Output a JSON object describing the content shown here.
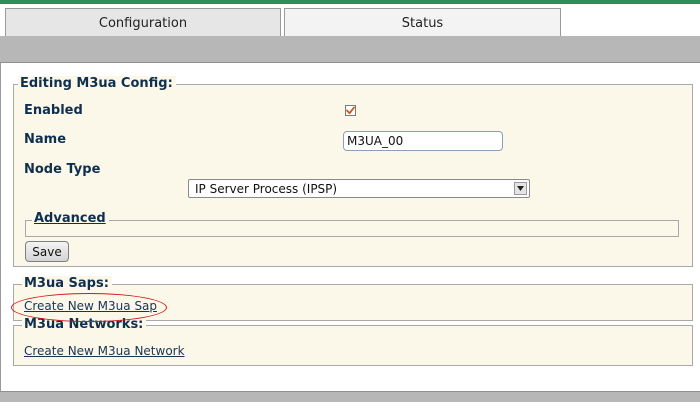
{
  "tabs": {
    "configuration": "Configuration",
    "status": "Status"
  },
  "edit": {
    "legend": "Editing M3ua Config:",
    "enabled_label": "Enabled",
    "enabled_checked": true,
    "name_label": "Name",
    "name_value": "M3UA_00",
    "node_type_label": "Node Type",
    "node_type_value": "IP Server Process (IPSP)",
    "advanced_label": "Advanced",
    "save_label": "Save"
  },
  "saps": {
    "legend": "M3ua Saps:",
    "create_link": "Create New M3ua Sap"
  },
  "networks": {
    "legend": "M3ua Networks:",
    "create_link": "Create New M3ua Network"
  },
  "colors": {
    "annotation": "#d21a1a",
    "panel_bg": "#fbf8ea",
    "label_text": "#0f2f4f",
    "checkmark": "#c45a1a"
  },
  "icons": {
    "checkbox": "checkmark-icon",
    "dropdown": "chevron-down-icon"
  }
}
